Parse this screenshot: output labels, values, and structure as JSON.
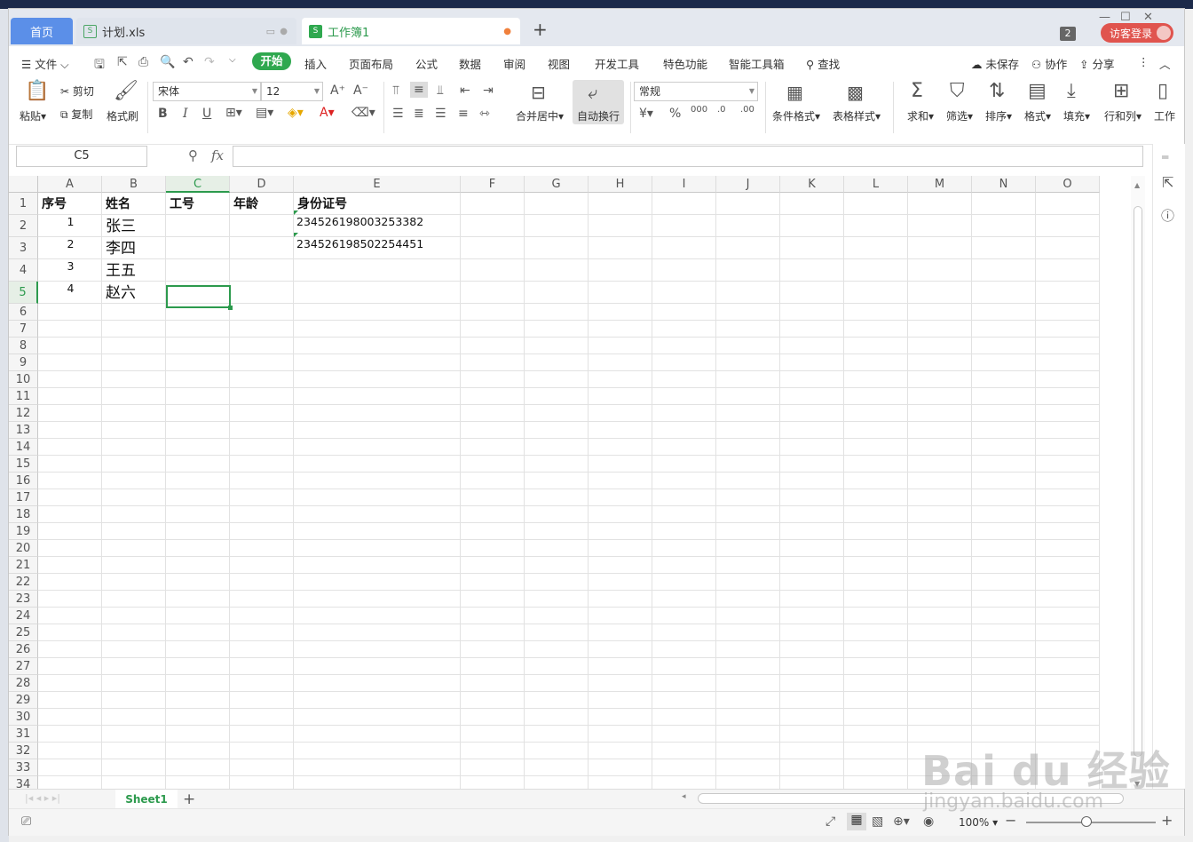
{
  "tabs": {
    "home": "首页",
    "file": "计划.xls",
    "active": "工作簿1",
    "login": "访客登录",
    "badge": "2"
  },
  "menu": {
    "file": "文件",
    "start": "开始",
    "items": [
      "插入",
      "页面布局",
      "公式",
      "数据",
      "审阅",
      "视图",
      "开发工具",
      "特色功能",
      "智能工具箱"
    ],
    "search": "查找",
    "unsaved": "未保存",
    "collab": "协作",
    "share": "分享"
  },
  "ribbon": {
    "paste": "粘贴",
    "cut": "剪切",
    "copy": "复制",
    "format_painter": "格式刷",
    "font_name": "宋体",
    "font_size": "12",
    "merge": "合并居中",
    "wrap": "自动换行",
    "number_format": "常规",
    "cond_format": "条件格式",
    "table_style": "表格样式",
    "sum": "求和",
    "filter": "筛选",
    "sort": "排序",
    "format": "格式",
    "fill": "填充",
    "row_col": "行和列",
    "worksheet": "工作"
  },
  "formula_bar": {
    "cell_ref": "C5",
    "fx": "fx",
    "content": ""
  },
  "columns": [
    "A",
    "B",
    "C",
    "D",
    "E",
    "F",
    "G",
    "H",
    "I",
    "J",
    "K",
    "L",
    "M",
    "N",
    "O"
  ],
  "selected_column": "C",
  "rows": [
    "1",
    "2",
    "3",
    "4",
    "5",
    "6",
    "7",
    "8",
    "9",
    "10",
    "11",
    "12",
    "13",
    "14",
    "15",
    "16",
    "17",
    "18",
    "19",
    "20",
    "21",
    "22",
    "23",
    "24",
    "25",
    "26",
    "27",
    "28",
    "29",
    "30",
    "31",
    "32",
    "33",
    "34"
  ],
  "selected_row": "5",
  "sheet": {
    "headers": [
      "序号",
      "姓名",
      "工号",
      "年龄",
      "身份证号"
    ],
    "data": [
      {
        "no": "1",
        "name": "张三",
        "id": "234526198003253382"
      },
      {
        "no": "2",
        "name": "李四",
        "id": "234526198502254451"
      },
      {
        "no": "3",
        "name": "王五",
        "id": ""
      },
      {
        "no": "4",
        "name": "赵六",
        "id": ""
      }
    ]
  },
  "sheet_tabs": [
    "Sheet1"
  ],
  "status": {
    "zoom": "100%"
  },
  "watermark": {
    "brand": "Bai du 经验",
    "url": "jingyan.baidu.com"
  },
  "colors": {
    "accent": "#2fa84f",
    "home_tab": "#5b8fe8",
    "login": "#e0544e"
  }
}
